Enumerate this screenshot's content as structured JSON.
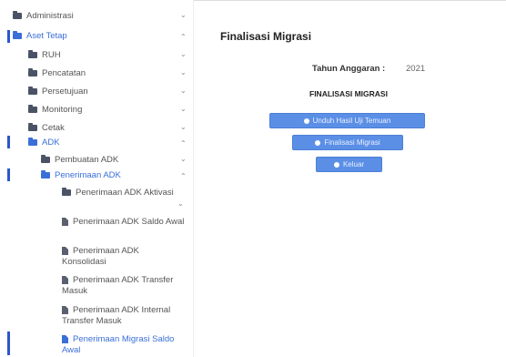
{
  "sidebar": {
    "items": [
      {
        "label": "Administrasi"
      },
      {
        "label": "Aset Tetap"
      },
      {
        "label": "RUH"
      },
      {
        "label": "Pencatatan"
      },
      {
        "label": "Persetujuan"
      },
      {
        "label": "Monitoring"
      },
      {
        "label": "Cetak"
      },
      {
        "label": "ADK"
      },
      {
        "label": "Pembuatan ADK"
      },
      {
        "label": "Penerimaan ADK"
      },
      {
        "label": "Penerimaan ADK Aktivasi"
      },
      {
        "label": "Penerimaan ADK Saldo Awal"
      },
      {
        "label": "Penerimaan ADK Konsolidasi"
      },
      {
        "label": "Penerimaan ADK Transfer Masuk"
      },
      {
        "label": "Penerimaan ADK Internal Transfer Masuk"
      },
      {
        "label": "Penerimaan Migrasi Saldo Awal"
      }
    ],
    "chevrons": {
      "up": "⌃",
      "down": "⌄"
    }
  },
  "main": {
    "title": "Finalisasi Migrasi",
    "tahun_label": "Tahun Anggaran :",
    "tahun_value": "2021",
    "heading": "FINALISASI MIGRASI",
    "buttons": {
      "unduh": "Unduh Hasil Uji Temuan",
      "finalisasi": "Finalisasi Migrasi",
      "keluar": "Keluar"
    }
  },
  "colors": {
    "accent": "#3a6fd8",
    "button": "#5b8fe6",
    "active_bar": "#2b57c9"
  }
}
